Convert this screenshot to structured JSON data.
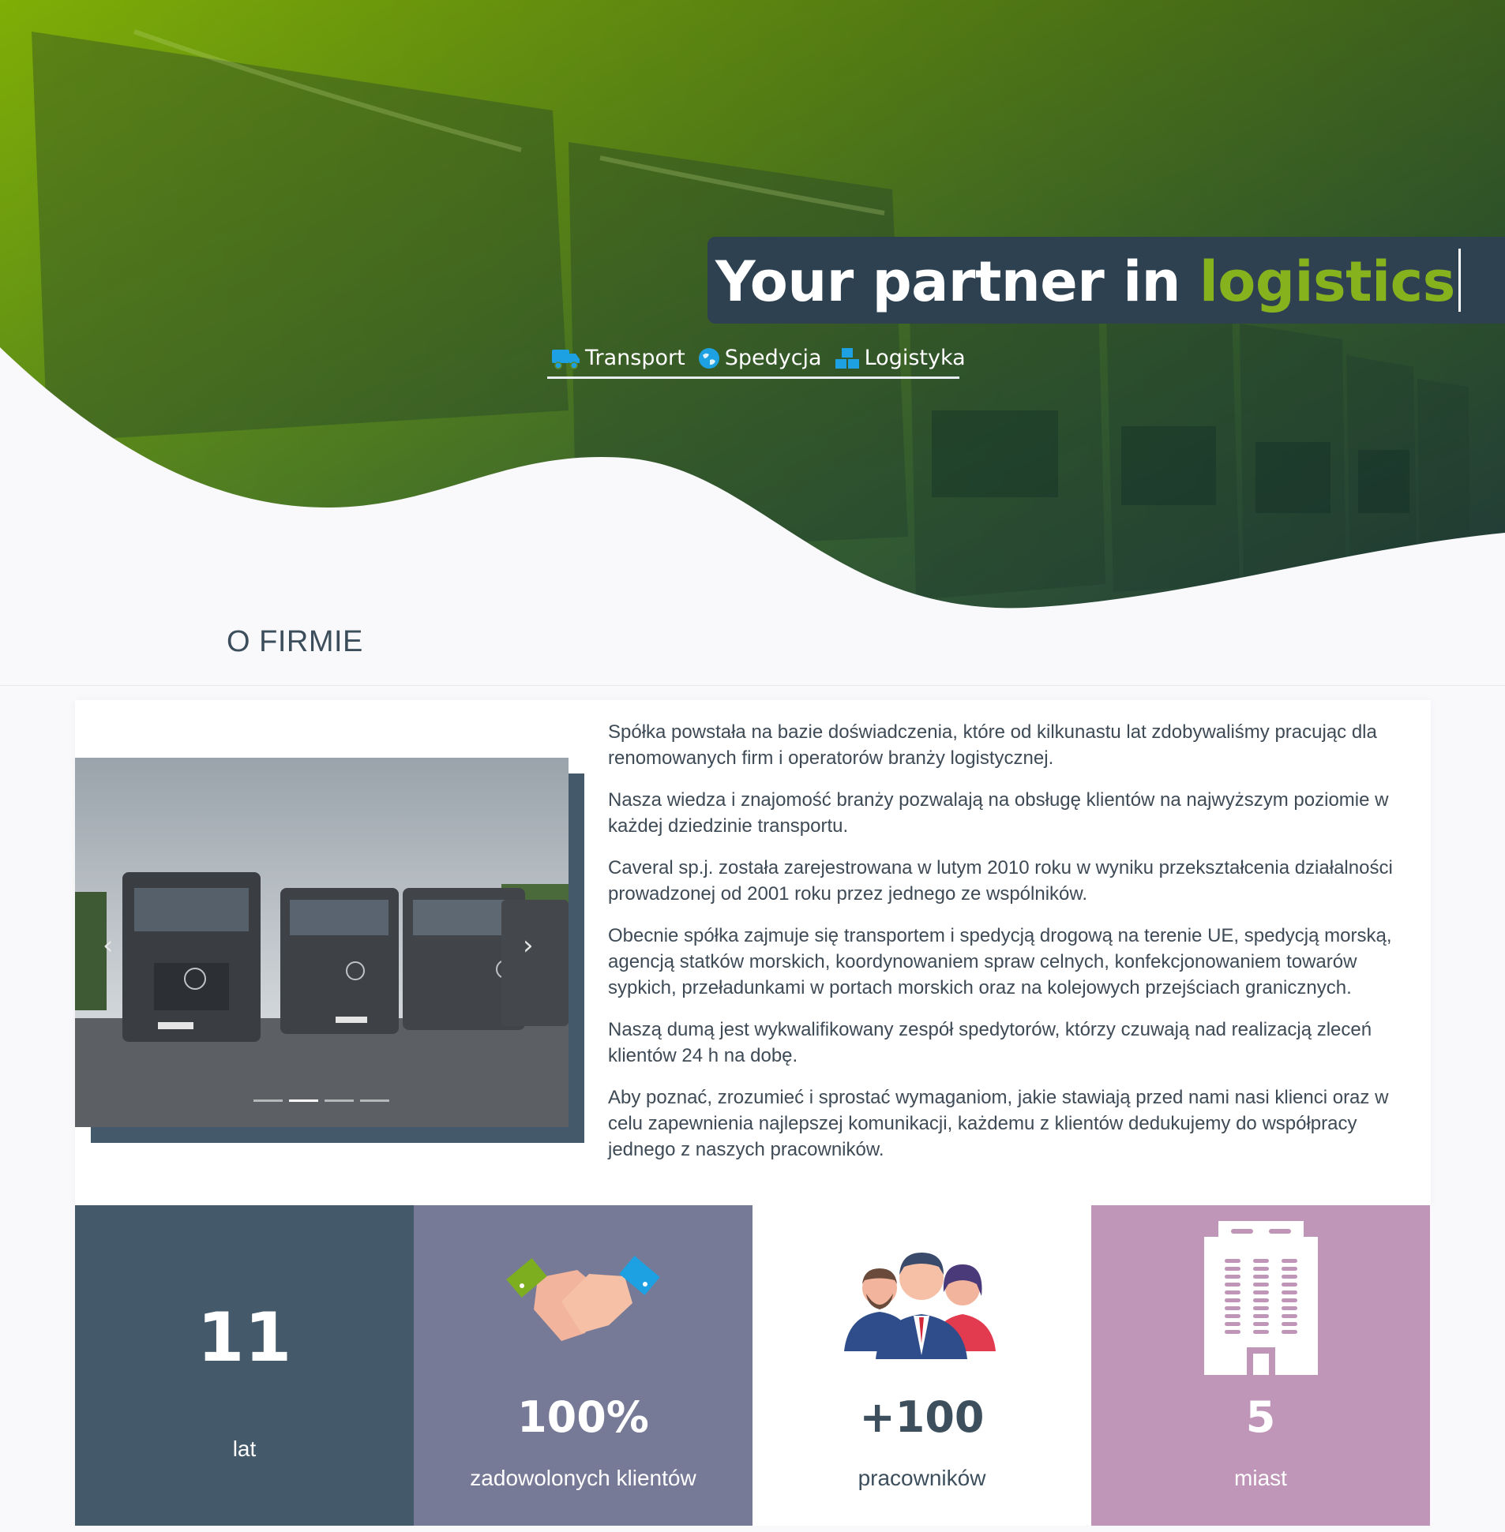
{
  "hero": {
    "headline_prefix": "Your partner in ",
    "headline_accent": "logistics",
    "services": [
      {
        "label": "Transport",
        "icon": "truck-icon"
      },
      {
        "label": "Spedycja",
        "icon": "globe-icon"
      },
      {
        "label": "Logistyka",
        "icon": "boxes-icon"
      }
    ]
  },
  "section": {
    "title": "O FIRMIE"
  },
  "slider": {
    "indicator_count": 4,
    "active_index": 1
  },
  "about": {
    "paragraphs": [
      "Spółka powstała na bazie doświadczenia, które od kilkunastu lat zdobywaliśmy pracując dla renomowanych firm i operatorów branży logistycznej.",
      "Nasza wiedza i znajomość branży pozwalają na obsługę klientów na najwyższym poziomie w każdej dziedzinie transportu.",
      "Caveral sp.j. została zarejestrowana w lutym 2010 roku w wyniku przekształcenia działalności prowadzonej od 2001 roku przez jednego ze wspólników.",
      "Obecnie spółka zajmuje się transportem i spedycją drogową na terenie UE, spedycją morską, agencją statków morskich, koordynowaniem spraw celnych, konfekcjonowaniem towarów sypkich, przeładunkami w portach morskich oraz na kolejowych przejściach granicznych.",
      "Naszą dumą jest wykwalifikowany zespół spedytorów, którzy czuwają nad realizacją zleceń klientów 24 h na dobę.",
      "Aby poznać, zrozumieć i sprostać wymaganiom, jakie stawiają przed nami nasi klienci oraz w celu zapewnienia najlepszej komunikacji, każdemu z klientów dedukujemy do współpracy jednego z naszych pracowników."
    ]
  },
  "stats": [
    {
      "value": "11",
      "label": "lat",
      "bg": "#44596a",
      "color": "#ffffff"
    },
    {
      "value": "100%",
      "label": "zadowolonych klientów",
      "bg": "#777a97",
      "color": "#ffffff",
      "icon": "handshake-icon"
    },
    {
      "value": "+100",
      "label": "pracowników",
      "bg": "#ffffff",
      "color": "#3d4f5d",
      "icon": "team-icon"
    },
    {
      "value": "5",
      "label": "miast",
      "bg": "#bf95b8",
      "color": "#ffffff",
      "icon": "building-icon"
    }
  ],
  "colors": {
    "accent": "#86b31d",
    "dark": "#2e4151",
    "service_icon": "#1ea1e2"
  }
}
